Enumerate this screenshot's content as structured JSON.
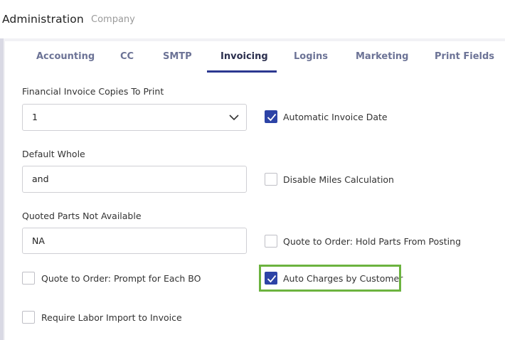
{
  "header": {
    "title": "Administration",
    "crumb": "Company"
  },
  "tabs": [
    {
      "label": "Accounting"
    },
    {
      "label": "CC"
    },
    {
      "label": "SMTP"
    },
    {
      "label": "Invoicing",
      "active": true
    },
    {
      "label": "Logins"
    },
    {
      "label": "Marketing"
    },
    {
      "label": "Print Fields"
    }
  ],
  "form": {
    "copies": {
      "label": "Financial Invoice Copies To Print",
      "value": "1"
    },
    "whole": {
      "label": "Default Whole",
      "value": "and"
    },
    "quoted": {
      "label": "Quoted Parts Not Available",
      "value": "NA"
    },
    "checkboxes": {
      "automatic_invoice_date": {
        "label": "Automatic Invoice Date",
        "checked": true
      },
      "disable_miles": {
        "label": "Disable Miles Calculation",
        "checked": false
      },
      "hold_parts": {
        "label": "Quote to Order: Hold Parts From Posting",
        "checked": false
      },
      "prompt_each_bo": {
        "label": "Quote to Order: Prompt for Each BO",
        "checked": false
      },
      "auto_charges": {
        "label": "Auto Charges by Customer",
        "checked": true
      },
      "labor_import": {
        "label": "Require Labor Import to Invoice",
        "checked": false
      }
    }
  },
  "colors": {
    "accent": "#2d43a6",
    "highlight": "#6cb33f"
  }
}
